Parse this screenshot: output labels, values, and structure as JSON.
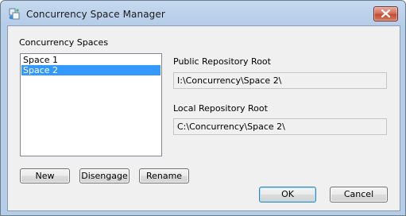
{
  "window": {
    "title": "Concurrency Space Manager",
    "icon": "app-icon",
    "close_icon": "close-icon",
    "close_color": "#c44a33"
  },
  "spaces": {
    "label": "Concurrency Spaces",
    "items": [
      {
        "label": "Space 1",
        "selected": false
      },
      {
        "label": "Space 2",
        "selected": true
      }
    ],
    "selection_color": "#3399ff"
  },
  "public_root": {
    "label": "Public Repository Root",
    "value": "I:\\Concurrency\\Space 2\\"
  },
  "local_root": {
    "label": "Local Repository Root",
    "value": "C:\\Concurrency\\Space 2\\"
  },
  "buttons": {
    "new": "New",
    "disengage": "Disengage",
    "rename": "Rename",
    "ok": "OK",
    "cancel": "Cancel"
  }
}
